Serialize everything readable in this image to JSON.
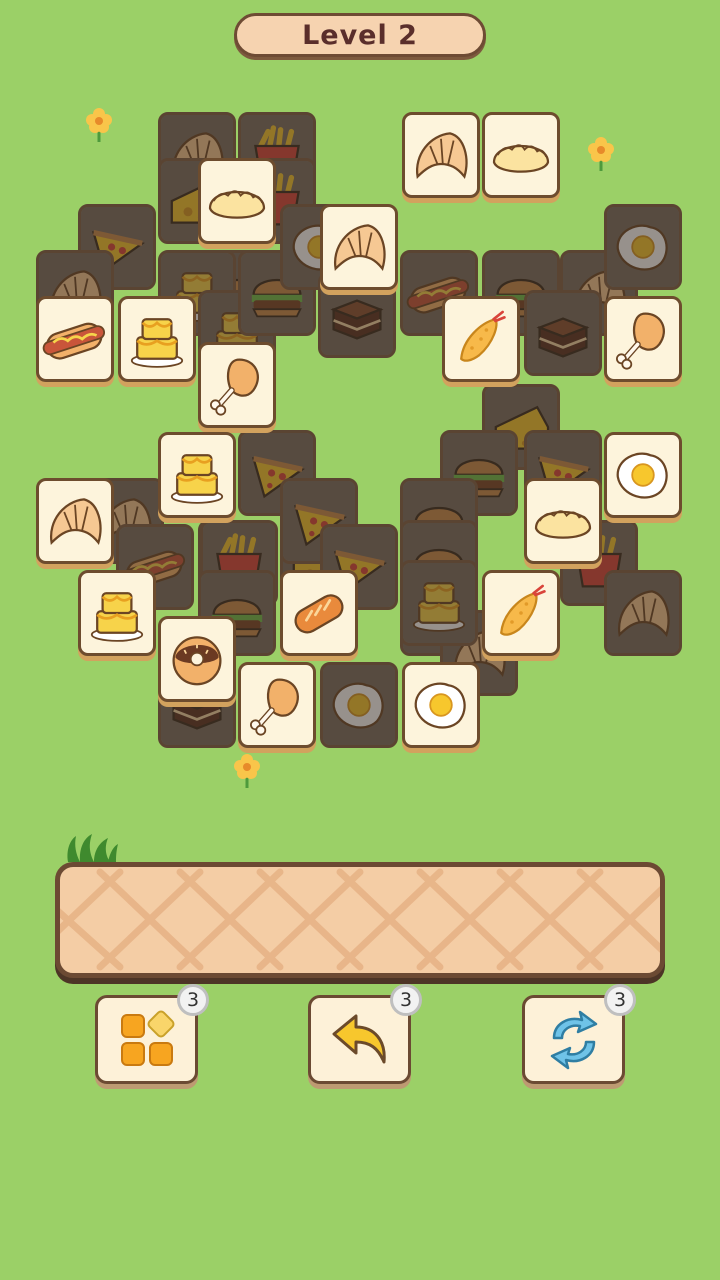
{
  "header": {
    "level_label": "Level 2"
  },
  "colors": {
    "background": "#9bd067",
    "tile_face": "#fdf4dc",
    "tile_shadow": "#d2a25e",
    "tile_border": "#6d4c2e",
    "tray_fill": "#f4cda5",
    "tray_border": "#6c4a33",
    "title_text": "#5a2e2b"
  },
  "board": {
    "free_tiles": [
      "dumpling",
      "croissant",
      "croissant",
      "dumpling",
      "hotdog",
      "cake",
      "chicken-leg",
      "fried-shrimp",
      "chicken-leg",
      "cake",
      "croissant",
      "fried-egg",
      "dumpling",
      "cake",
      "baguette",
      "fried-shrimp",
      "donut",
      "chicken-leg",
      "fried-egg"
    ],
    "covered_tiles": [
      "croissant",
      "fries",
      "cheese",
      "pizza",
      "croissant",
      "dumpling",
      "burger",
      "cake",
      "cake",
      "fries",
      "pizza",
      "burger",
      "fried-egg",
      "brownie",
      "hotdog",
      "burger",
      "cheese",
      "croissant",
      "fried-egg",
      "pizza",
      "burger",
      "fries",
      "croissant",
      "hotdog",
      "cake",
      "cheese",
      "burger",
      "brownie",
      "pizza",
      "fries",
      "dumpling",
      "burger",
      "croissant",
      "pizza",
      "burger",
      "fried-egg",
      "croissant",
      "cake",
      "brownie"
    ]
  },
  "tray": {
    "slots_filled": 0
  },
  "powerups": [
    {
      "icon": "shuffle-blocks-icon",
      "count": "3"
    },
    {
      "icon": "undo-arrow-icon",
      "count": "3"
    },
    {
      "icon": "refresh-icon",
      "count": "3"
    }
  ]
}
